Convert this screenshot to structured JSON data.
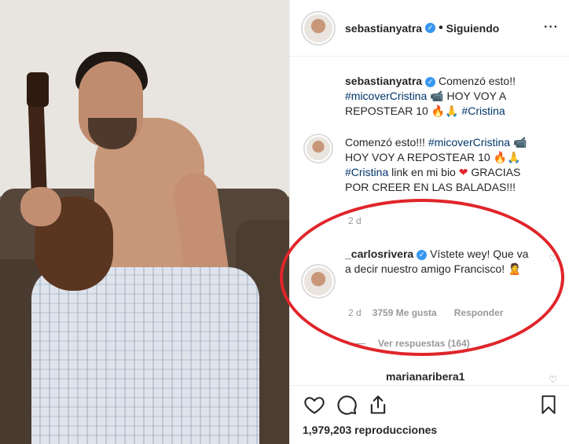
{
  "post": {
    "owner": "sebastianyatra",
    "following_label": "Siguiendo",
    "views": "1,979,203 reproducciones"
  },
  "comments": [
    {
      "user": "sebastianyatra",
      "text_a": " Comenzó esto!! ",
      "tag1": "#micoverCristina",
      "text_b": " HOY VOY A REPOSTEAR 10 ",
      "tag2": "#Cristina"
    },
    {
      "text_a": "Comenzó esto!!! ",
      "tag1": "#micoverCristina",
      "text_b": " HOY VOY A REPOSTEAR 10 ",
      "tag2": "#Cristina",
      "text_c": " link en mi bio ",
      "text_d": " GRACIAS POR CREER EN LAS BALADAS!!!",
      "time": "2 d"
    },
    {
      "user": "_carlosrivera",
      "text": " Vístete wey! Que va a decir nuestro amigo Francisco! ",
      "time": "2 d",
      "likes": "3759 Me gusta",
      "reply": "Responder",
      "view_replies": "Ver respuestas (164)"
    },
    {
      "user": "marianaribera1"
    }
  ],
  "icons": {
    "verified": "verified-badge",
    "like": "heart-icon",
    "comment": "comment-icon",
    "share": "share-icon",
    "save": "bookmark-icon",
    "more": "more-icon"
  },
  "colors": {
    "highlight_oval": "#e0252a",
    "hashtag": "#003569",
    "verified": "#3897f0"
  }
}
